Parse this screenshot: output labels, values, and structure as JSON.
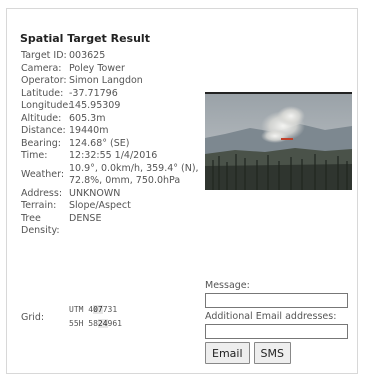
{
  "title": "Spatial Target Result",
  "fields": [
    {
      "key": "Target ID:",
      "value": "003625"
    },
    {
      "key": "Camera:",
      "value": "Poley Tower"
    },
    {
      "key": "Operator:",
      "value": "Simon Langdon"
    },
    {
      "key": "Latitude:",
      "value": "-37.71796"
    },
    {
      "key": "Longitude:",
      "value": "145.95309"
    },
    {
      "key": "Altitude:",
      "value": "605.3m"
    },
    {
      "key": "Distance:",
      "value": "19440m"
    },
    {
      "key": "Bearing:",
      "value": "124.68° (SE)"
    },
    {
      "key": "Time:",
      "value": "12:32:55 1/4/2016"
    },
    {
      "key": "Weather:",
      "value": "10.9°, 0.0km/h, 359.4° (N), 72.8%, 0mm, 750.0hPa"
    },
    {
      "key": "Address:",
      "value": "UNKNOWN"
    },
    {
      "key": "Terrain:",
      "value": "Slope/Aspect"
    },
    {
      "key": "Tree Density:",
      "value": "DENSE"
    }
  ],
  "grid": {
    "label": "Grid:",
    "line1": {
      "pre": "UTM  4",
      "hl": "07",
      "post": "731"
    },
    "line2": {
      "pre": "55H 58",
      "hl": "24",
      "post": "961"
    }
  },
  "form": {
    "message_label": "Message:",
    "message_value": "",
    "emails_label": "Additional Email addresses:",
    "emails_value": "",
    "email_button": "Email",
    "sms_button": "SMS"
  }
}
